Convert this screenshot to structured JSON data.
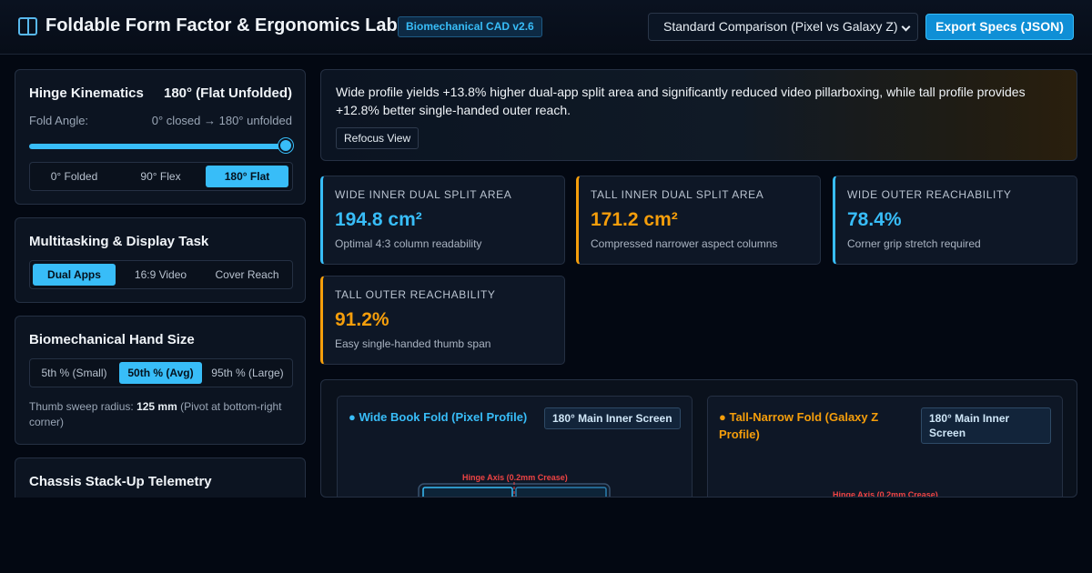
{
  "header": {
    "title": "Foldable Form Factor & Ergonomics Lab",
    "badge": "Biomechanical CAD v2.6",
    "preset_selected": "Standard Comparison (Pixel vs Galaxy Z)",
    "export_label": "Export Specs (JSON)"
  },
  "hinge": {
    "title": "Hinge Kinematics",
    "value": "180° (Flat Unfolded)",
    "fold_label": "Fold Angle:",
    "range_text": "0° closed → 180° unfolded",
    "slider_value": 180,
    "slider_max": 180,
    "options": [
      "0° Folded",
      "90° Flex",
      "180° Flat"
    ],
    "active": "180° Flat"
  },
  "task": {
    "title": "Multitasking & Display Task",
    "options": [
      "Dual Apps",
      "16:9 Video",
      "Cover Reach"
    ],
    "active": "Dual Apps"
  },
  "hand": {
    "title": "Biomechanical Hand Size",
    "options": [
      "5th % (Small)",
      "50th % (Avg)",
      "95th % (Large)"
    ],
    "active": "50th % (Avg)",
    "sweep_prefix": "Thumb sweep radius:",
    "sweep_value": "125 mm",
    "sweep_suffix": "(Pivot at bottom-right corner)"
  },
  "chassis": {
    "title": "Chassis Stack-Up Telemetry"
  },
  "insight": {
    "text": "Wide profile yields +13.8% higher dual-app split area and significantly reduced video pillarboxing, while tall profile provides +12.8% better single-handed outer reach.",
    "button": "Refocus View"
  },
  "metrics": [
    {
      "label": "WIDE INNER DUAL SPLIT AREA",
      "value": "194.8 cm²",
      "sub": "Optimal 4:3 column readability",
      "accent": "#38bdf8"
    },
    {
      "label": "TALL INNER DUAL SPLIT AREA",
      "value": "171.2 cm²",
      "sub": "Compressed narrower aspect columns",
      "accent": "#f59e0b"
    },
    {
      "label": "WIDE OUTER REACHABILITY",
      "value": "78.4%",
      "sub": "Corner grip stretch required",
      "accent": "#38bdf8"
    },
    {
      "label": "TALL OUTER REACHABILITY",
      "value": "91.2%",
      "sub": "Easy single-handed thumb span",
      "accent": "#f59e0b"
    }
  ],
  "previews": [
    {
      "title": "● Wide Book Fold (Pixel Profile)",
      "badge": "180° Main Inner Screen",
      "hinge": "Hinge Axis (0.2mm Crease)",
      "color": "#38bdf8"
    },
    {
      "title": "● Tall-Narrow Fold (Galaxy Z Profile)",
      "badge": "180° Main Inner Screen",
      "hinge": "Hinge Axis (0.2mm Crease)",
      "color": "#f59e0b"
    }
  ],
  "colors": {
    "accent_blue": "#38bdf8",
    "accent_orange": "#f59e0b",
    "hinge_red": "#ef4444",
    "background": "#030812"
  }
}
